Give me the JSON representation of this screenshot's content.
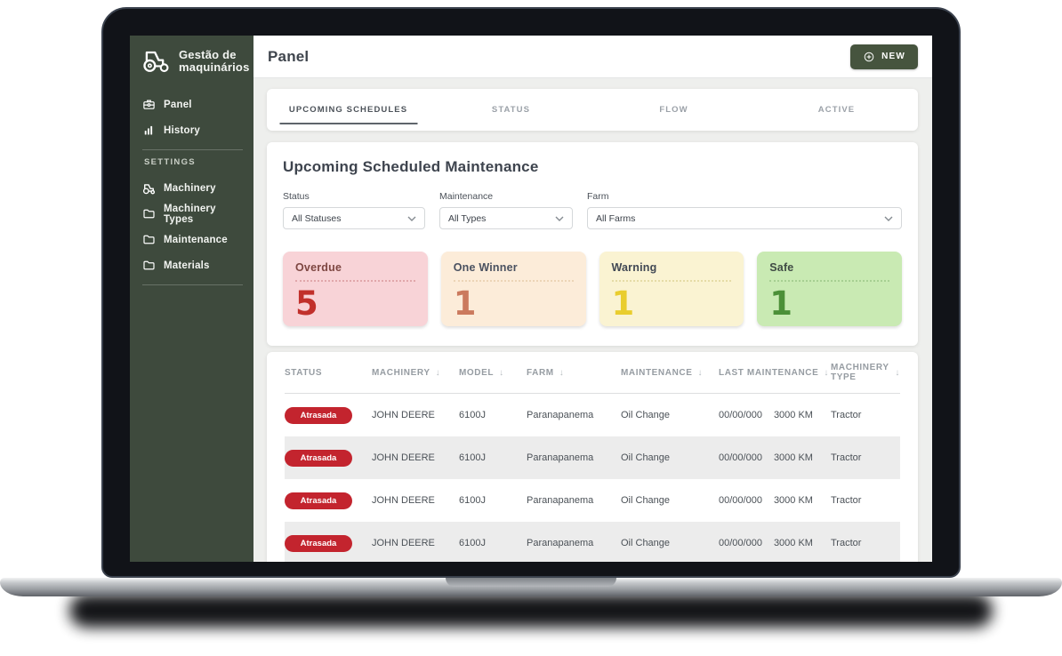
{
  "sidebar": {
    "logo_line1": "Gestão de",
    "logo_line2": "maquinários",
    "items": [
      {
        "label": "Panel",
        "icon": "panel-icon"
      },
      {
        "label": "History",
        "icon": "history-icon"
      }
    ],
    "section_label": "SETTINGS",
    "settings_items": [
      {
        "label": "Machinery",
        "icon": "tractor-icon"
      },
      {
        "label": "Machinery Types",
        "icon": "folder-icon"
      },
      {
        "label": "Maintenance",
        "icon": "folder-icon"
      },
      {
        "label": "Materials",
        "icon": "folder-icon"
      }
    ]
  },
  "header": {
    "title": "Panel",
    "new_button_label": "NEW"
  },
  "tabs": [
    {
      "label": "UPCOMING SCHEDULES",
      "active": true
    },
    {
      "label": "STATUS",
      "active": false
    },
    {
      "label": "FLOW",
      "active": false
    },
    {
      "label": "ACTIVE",
      "active": false
    }
  ],
  "maintenance_panel": {
    "title": "Upcoming Scheduled Maintenance",
    "filters": [
      {
        "label": "Status",
        "value": "All Statuses"
      },
      {
        "label": "Maintenance",
        "value": "All Types"
      },
      {
        "label": "Farm",
        "value": "All Farms"
      }
    ],
    "stats": [
      {
        "label": "Overdue",
        "value": "5",
        "theme": "overdue",
        "bg": "#f8d3d7",
        "number_color": "#c1302b"
      },
      {
        "label": "One Winner",
        "value": "1",
        "theme": "winner",
        "bg": "#fcecd9",
        "number_color": "#cb7a5e"
      },
      {
        "label": "Warning",
        "value": "1",
        "theme": "warning",
        "bg": "#faf3d2",
        "number_color": "#e9cd2e"
      },
      {
        "label": "Safe",
        "value": "1",
        "theme": "safe",
        "bg": "#c9eab3",
        "number_color": "#4c9038"
      }
    ]
  },
  "table": {
    "sort_glyph": "↓",
    "columns": [
      {
        "label": "STATUS",
        "sortable": false
      },
      {
        "label": "MACHINERY",
        "sortable": true
      },
      {
        "label": "MODEL",
        "sortable": true
      },
      {
        "label": "FARM",
        "sortable": true
      },
      {
        "label": "MAINTENANCE",
        "sortable": true
      },
      {
        "label": "LAST MAINTENANCE",
        "sortable": true
      },
      {
        "label": "MACHINERY TYPE",
        "sortable": true
      }
    ],
    "rows": [
      {
        "status": "Atrasada",
        "machinery": "JOHN DEERE",
        "model": "6100J",
        "farm": "Paranapanema",
        "maintenance": "Oil Change",
        "last_date": "00/00/000",
        "last_km": "3000 KM",
        "type": "Tractor"
      },
      {
        "status": "Atrasada",
        "machinery": "JOHN DEERE",
        "model": "6100J",
        "farm": "Paranapanema",
        "maintenance": "Oil Change",
        "last_date": "00/00/000",
        "last_km": "3000 KM",
        "type": "Tractor"
      },
      {
        "status": "Atrasada",
        "machinery": "JOHN DEERE",
        "model": "6100J",
        "farm": "Paranapanema",
        "maintenance": "Oil Change",
        "last_date": "00/00/000",
        "last_km": "3000 KM",
        "type": "Tractor"
      },
      {
        "status": "Atrasada",
        "machinery": "JOHN DEERE",
        "model": "6100J",
        "farm": "Paranapanema",
        "maintenance": "Oil Change",
        "last_date": "00/00/000",
        "last_km": "3000 KM",
        "type": "Tractor"
      }
    ]
  },
  "colors": {
    "sidebar_green": "#3e4a3d",
    "button_green": "#46543e",
    "badge_red": "#c3242e",
    "content_bg": "#eeefed",
    "alt_row": "#ececec"
  }
}
